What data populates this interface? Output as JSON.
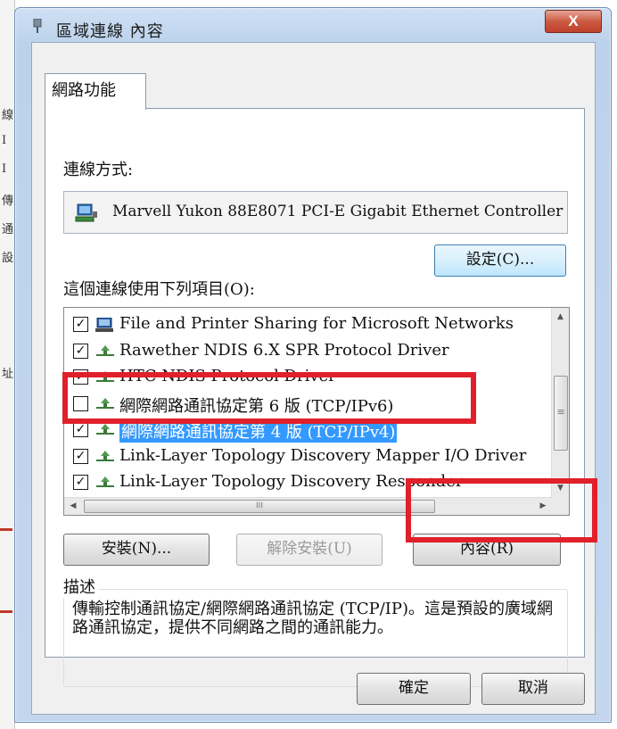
{
  "window": {
    "title": "區域連線 內容",
    "close_label": "X"
  },
  "tab": {
    "label": "網路功能"
  },
  "connect_using": {
    "label": "連線方式:",
    "adapter": "Marvell Yukon 88E8071 PCI-E Gigabit Ethernet Controller",
    "configure_button": "設定(C)..."
  },
  "items": {
    "label": "這個連線使用下列項目(O):",
    "list": [
      {
        "checked": true,
        "icon": "computer-share-icon",
        "text": "File and Printer Sharing for Microsoft Networks"
      },
      {
        "checked": true,
        "icon": "network-protocol-icon",
        "text": "Rawether NDIS 6.X SPR Protocol Driver"
      },
      {
        "checked": true,
        "icon": "network-protocol-icon",
        "text": "HTC NDIS Protocol Driver"
      },
      {
        "checked": false,
        "icon": "network-protocol-icon",
        "text": "網際網路通訊協定第 6 版 (TCP/IPv6)"
      },
      {
        "checked": true,
        "icon": "network-protocol-icon",
        "text": "網際網路通訊協定第 4 版 (TCP/IPv4)",
        "selected": true
      },
      {
        "checked": true,
        "icon": "network-protocol-icon",
        "text": "Link-Layer Topology Discovery Mapper I/O Driver"
      },
      {
        "checked": true,
        "icon": "network-protocol-icon",
        "text": "Link-Layer Topology Discovery Responder"
      }
    ]
  },
  "buttons": {
    "install": "安裝(N)...",
    "uninstall": "解除安裝(U)",
    "properties": "內容(R)"
  },
  "description": {
    "title": "描述",
    "text": "傳輸控制通訊協定/網際網路通訊協定 (TCP/IP)。這是預設的廣域網路通訊協定，提供不同網路之間的通訊能力。"
  },
  "footer": {
    "ok": "確定",
    "cancel": "取消"
  },
  "colors": {
    "selection": "#3399ff",
    "highlight_box": "#e0202a",
    "close_button": "#c0412a"
  }
}
